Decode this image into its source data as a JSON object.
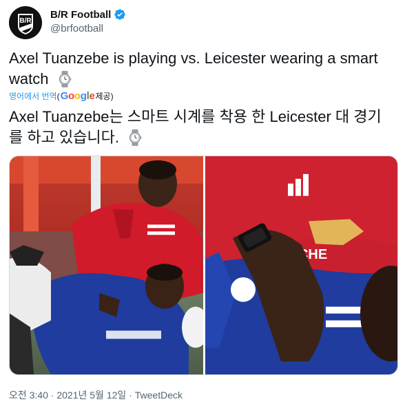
{
  "account": {
    "display_name": "B/R Football",
    "handle": "@brfootball",
    "avatar_text": "B/R",
    "verified": true
  },
  "tweet": {
    "text": "Axel Tuanzebe is playing vs. Leicester wearing a smart watch",
    "emoji": "watch-emoji"
  },
  "translation": {
    "label": "영어에서 번역",
    "paren_open": "(",
    "provider": "Google",
    "provided": " 제공)",
    "text": "Axel Tuanzebe는 스마트 시계를 착용 한 Leicester 대 경기를 하고 있습니다."
  },
  "media": {
    "count": 2
  },
  "footer": {
    "time": "오전 3:40",
    "date": "2021년 5월 12일",
    "separator": " · ",
    "source": "TweetDeck"
  },
  "colors": {
    "link": "#1d9bf0",
    "secondary": "#536471",
    "verified": "#1d9bf0",
    "man_utd_red": "#d11a2a",
    "leicester_blue": "#1f3c9e"
  }
}
